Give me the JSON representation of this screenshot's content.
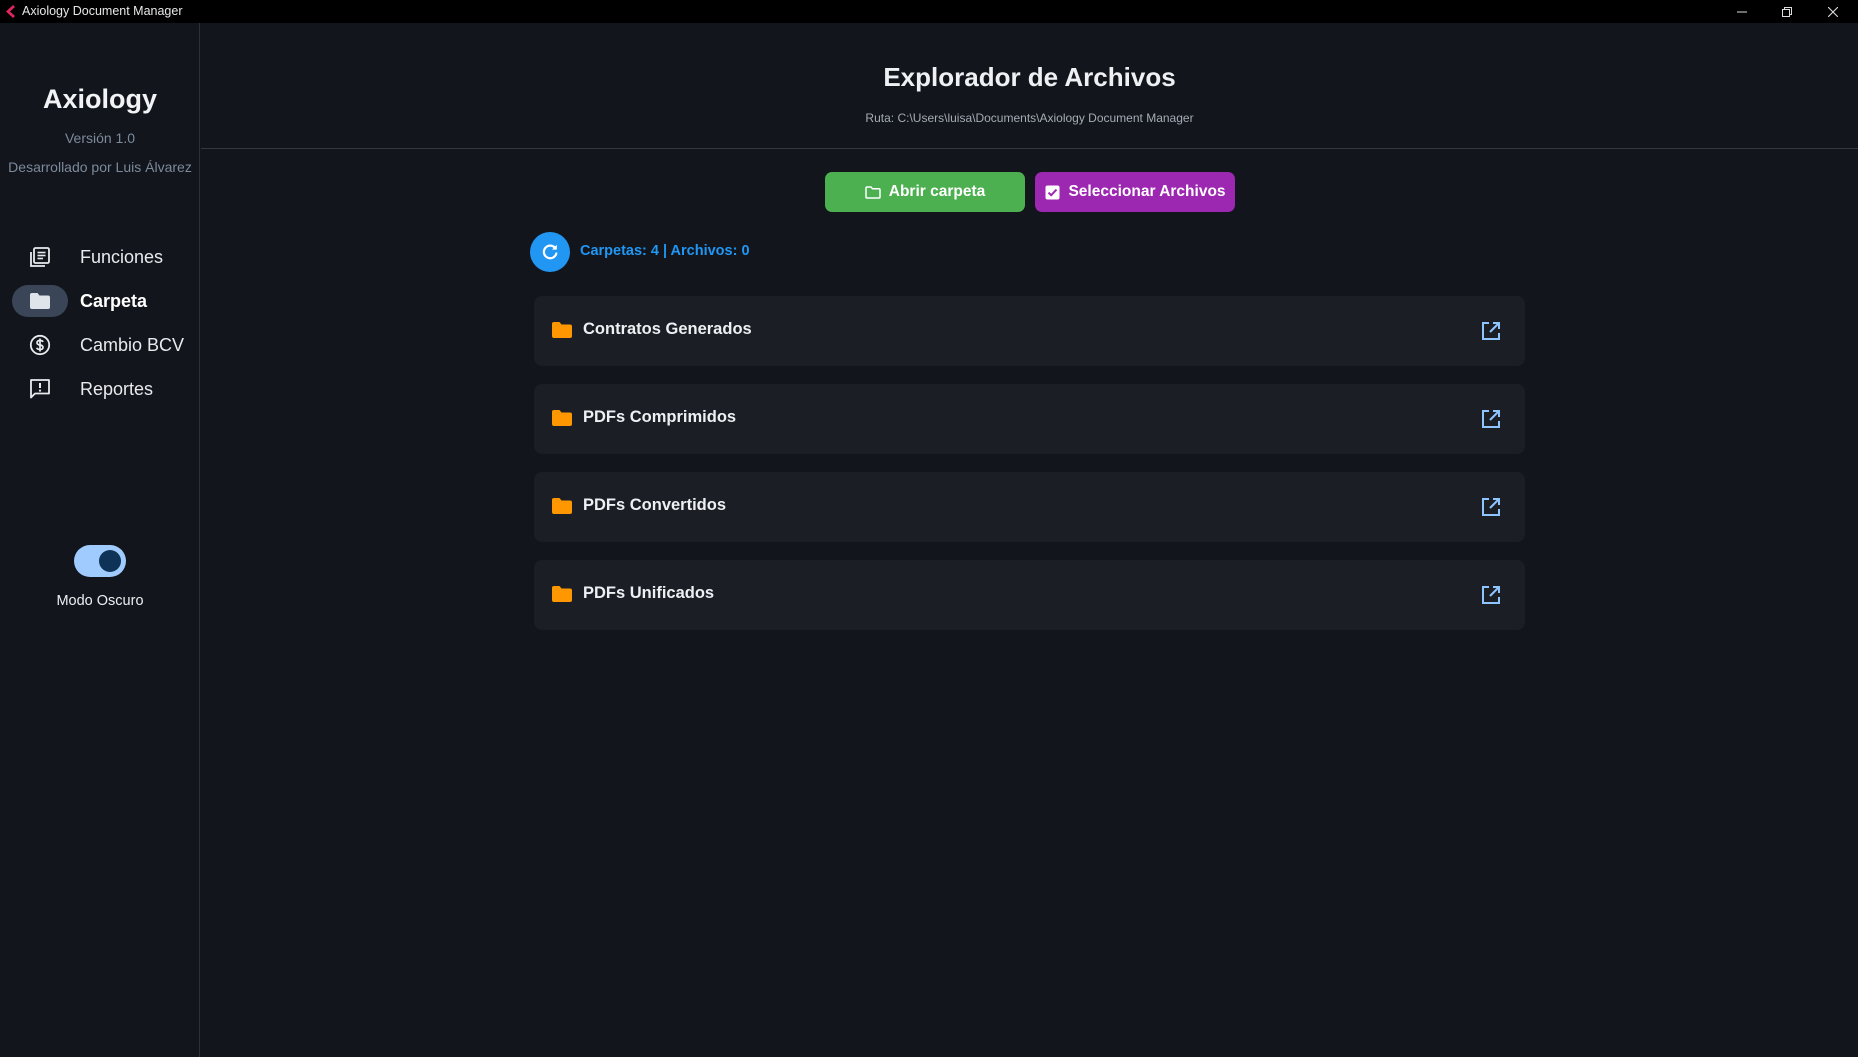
{
  "window": {
    "title": "Axiology Document Manager"
  },
  "sidebar": {
    "brand": "Axiology",
    "version": "Versión 1.0",
    "developer": "Desarrollado por Luis Álvarez",
    "items": [
      {
        "label": "Funciones",
        "icon": "library-icon",
        "active": false
      },
      {
        "label": "Carpeta",
        "icon": "folder-icon",
        "active": true
      },
      {
        "label": "Cambio BCV",
        "icon": "dollar-circle-icon",
        "active": false
      },
      {
        "label": "Reportes",
        "icon": "report-icon",
        "active": false
      }
    ],
    "dark_mode": {
      "label": "Modo Oscuro",
      "on": true
    }
  },
  "main": {
    "title": "Explorador de Archivos",
    "path": "Ruta: C:\\Users\\luisa\\Documents\\Axiology Document Manager",
    "open_folder_label": "Abrir carpeta",
    "select_files_label": "Seleccionar Archivos",
    "counts": "Carpetas: 4 | Archivos: 0",
    "folders": [
      {
        "name": "Contratos Generados"
      },
      {
        "name": "PDFs Comprimidos"
      },
      {
        "name": "PDFs Convertidos"
      },
      {
        "name": "PDFs Unificados"
      }
    ]
  },
  "colors": {
    "background": "#12151b",
    "card": "#1b1e25",
    "green": "#4caf50",
    "purple": "#9c27b0",
    "blue": "#2196f3",
    "folder": "#ff9800",
    "link": "#8ec5ff"
  }
}
